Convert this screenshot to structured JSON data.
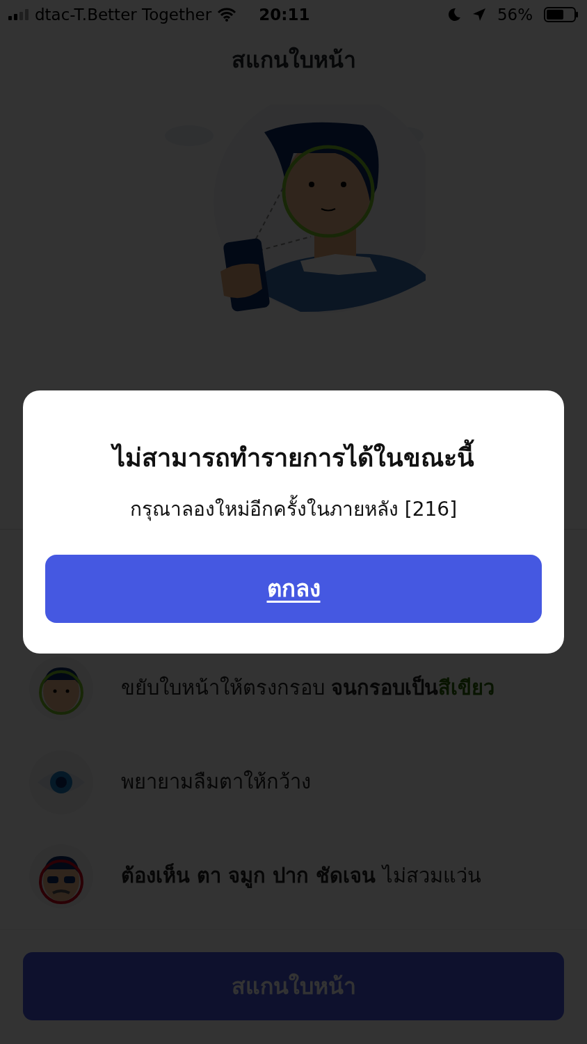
{
  "status_bar": {
    "carrier": "dtac-T.Better Together",
    "time": "20:11",
    "battery": "56%"
  },
  "header": {
    "title": "สแกนใบหน้า"
  },
  "tips": [
    {
      "kind": "frame",
      "segments": [
        {
          "text": "ขยับใบหน้าให้ตรงกรอบ ",
          "kind": "plain"
        },
        {
          "text": "จนกรอบเป็น",
          "kind": "bold"
        },
        {
          "text": "สีเขียว",
          "kind": "highlight"
        }
      ]
    },
    {
      "kind": "eye",
      "segments": [
        {
          "text": "พยายามลืมตาให้กว้าง",
          "kind": "plain"
        }
      ]
    },
    {
      "kind": "glasses",
      "segments": [
        {
          "text": "ต้องเห็น ตา จมูก ปาก ชัดเจน",
          "kind": "bold"
        },
        {
          "text": " ไม่สวมแว่น",
          "kind": "plain"
        }
      ]
    }
  ],
  "scan_button": {
    "label": "สแกนใบหน้า"
  },
  "dialog": {
    "title": "ไม่สามารถทำรายการได้ในขณะนี้",
    "message": "กรุณาลองใหม่อีกครั้งในภายหลัง [216]",
    "ok_button": "ตกลง"
  }
}
